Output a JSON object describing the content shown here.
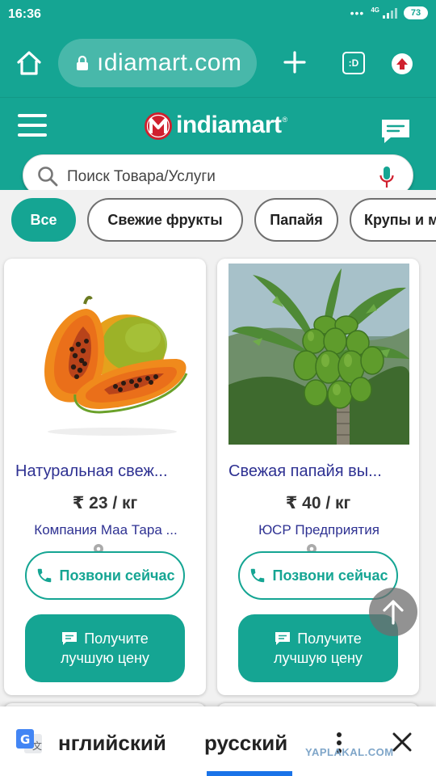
{
  "status_bar": {
    "time": "16:36",
    "network": "4G",
    "battery": "73"
  },
  "browser": {
    "url": "ıdiamart.com",
    "tab_count": ":D"
  },
  "site": {
    "logo_text": "indiamart",
    "logo_reg": "®"
  },
  "search": {
    "placeholder": "Поиск Товара/Услуги"
  },
  "chips": [
    "Все",
    "Свежие фрукты",
    "Папайя",
    "Крупы и м"
  ],
  "products": [
    {
      "title": "Натуральная свеж...",
      "price": "₹ 23 / кг",
      "supplier": "Компания Маа Тара ...",
      "location": "..",
      "call_label": "Позвони сейчас",
      "price_btn_line1": "Получите",
      "price_btn_line2": "лучшую цену"
    },
    {
      "title": "Свежая папайя вы...",
      "price": "₹ 40 / кг",
      "supplier": "ЮСР Предприятия",
      "location": "..",
      "call_label": "Позвони сейчас",
      "price_btn_line1": "Получите",
      "price_btn_line2": "лучшую цену"
    }
  ],
  "translate": {
    "source_lang": "нглийский",
    "target_lang": "русский"
  },
  "watermark": "YAPLAKAL.COM",
  "colors": {
    "brand": "#15a593",
    "title": "#2e3192",
    "accent_red": "#d0202e"
  }
}
